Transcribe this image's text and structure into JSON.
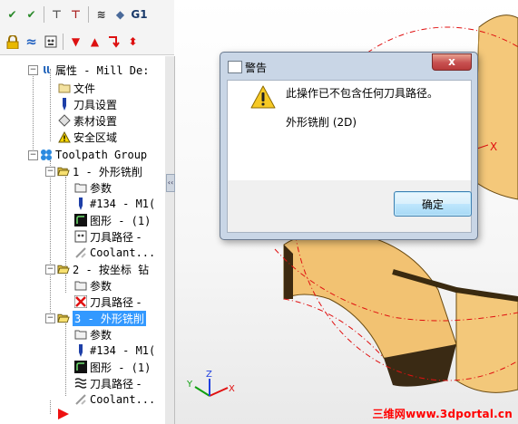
{
  "toolbar": {
    "row1": [
      {
        "name": "check-all-icon",
        "glyph": "✔",
        "color": "#2a8a2a"
      },
      {
        "name": "check-selected-icon",
        "glyph": "✔",
        "color": "#2a8a2a"
      },
      {
        "name": "tool-icon",
        "glyph": "⊤",
        "color": "#555555"
      },
      {
        "name": "tool-delete-icon",
        "glyph": "⊤",
        "color": "#aa2222"
      },
      {
        "name": "waves-icon",
        "glyph": "≋",
        "color": "#333333"
      },
      {
        "name": "cube-icon",
        "glyph": "◆",
        "color": "#4a6a9a"
      },
      {
        "name": "g1-label",
        "text": "G1",
        "color": "#1a3a6a"
      }
    ],
    "row2": [
      {
        "name": "lock-icon",
        "glyph": "🔒",
        "color": "#b08000"
      },
      {
        "name": "toolpath-waves-icon",
        "glyph": "≈",
        "color": "#2060c0"
      },
      {
        "name": "coolant-icon",
        "glyph": "⊡",
        "color": "#444444"
      },
      {
        "name": "arrow-down-icon",
        "glyph": "▼",
        "color": "#dd1111"
      },
      {
        "name": "arrow-up-icon",
        "glyph": "▲",
        "color": "#dd1111"
      },
      {
        "name": "move-to-icon",
        "glyph": "⮥",
        "color": "#dd1111"
      },
      {
        "name": "sort-icon",
        "glyph": "⬍",
        "color": "#dd1111"
      }
    ]
  },
  "tree": {
    "properties": "属性 - Mill De:",
    "file": "文件",
    "tool_settings": "刀具设置",
    "stock_settings": "素材设置",
    "safe_zone": "安全区域",
    "toolpath_group": "Toolpath Group",
    "op1": "1 - 外形铣削",
    "op1_params": "参数",
    "op1_tool": "#134 - M1(",
    "op1_geometry": "图形 - (1)",
    "op1_toolpath": "刀具路径 -",
    "op1_coolant": "Coolant...",
    "op2": "2 - 按坐标 钻",
    "op2_params": "参数",
    "op2_toolpath": "刀具路径 -",
    "op3": "3 - 外形铣削",
    "op3_params": "参数",
    "op3_tool": "#134 - M1(",
    "op3_geometry": "图形 - (1)",
    "op3_toolpath": "刀具路径 -",
    "op3_coolant": "Coolant..."
  },
  "dialog": {
    "title": "警告",
    "close_label": "x",
    "message": "此操作已不包含任何刀具路径。",
    "detail": "外形铣削 (2D)",
    "ok_label": "确定"
  },
  "viewport": {
    "axis_x": "X",
    "axis_y": "Y",
    "axis_z": "Z",
    "part_color": "#f4c87a"
  },
  "watermark": "三维网www.3dportal.cn"
}
